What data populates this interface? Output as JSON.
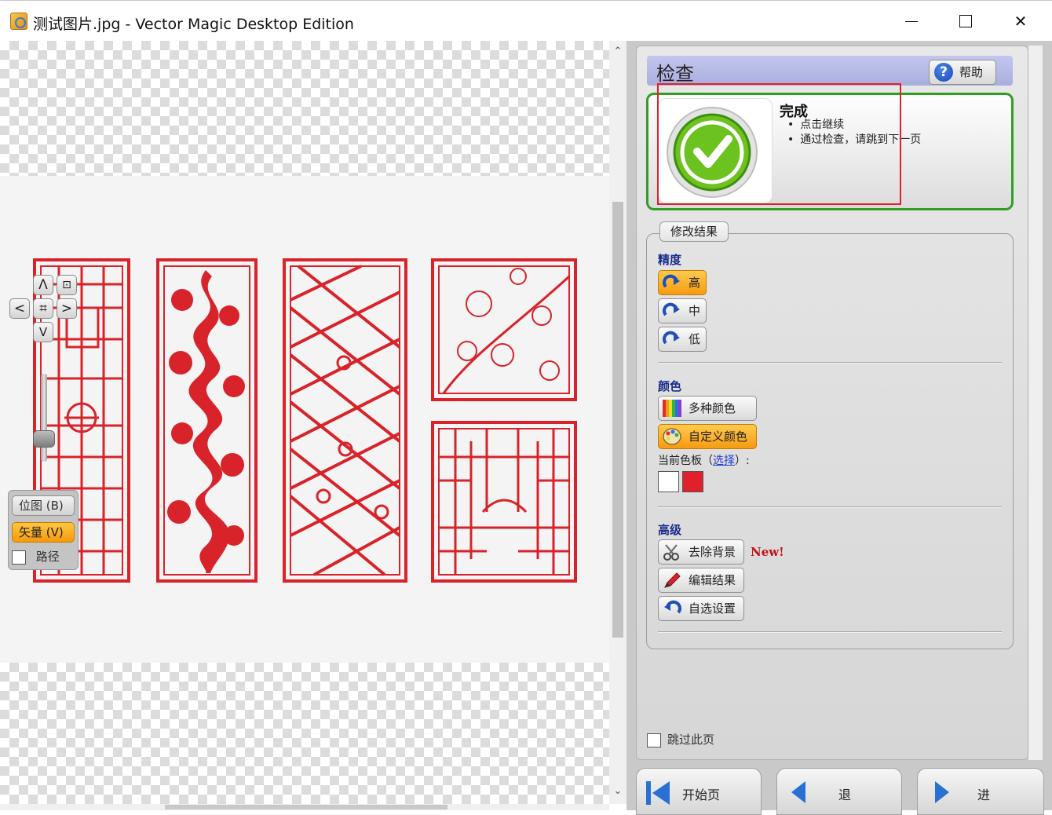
{
  "window": {
    "title": "测试图片.jpg - Vector Magic Desktop Edition",
    "controls": {
      "minimize": "",
      "maximize": "",
      "close": "✕"
    }
  },
  "canvas_nav": {
    "up": "Λ",
    "down": "V",
    "left": "<",
    "right": ">",
    "center": "⌗",
    "fit": "⊡"
  },
  "view_modes": {
    "bitmap": "位图  (B)",
    "vector": "矢量  (V)",
    "paths": "路径"
  },
  "panel": {
    "title": "检查",
    "help": "帮助",
    "status": {
      "title": "完成",
      "bullets": [
        "点击继续",
        "通过检查，请跳到下一页"
      ]
    },
    "group_label": "修改结果",
    "precision": {
      "label": "精度",
      "options": [
        "高",
        "中",
        "低"
      ],
      "selected": "高"
    },
    "color": {
      "label": "颜色",
      "options": [
        "多种颜色",
        "自定义颜色"
      ],
      "selected": "自定义颜色",
      "palette_label": "当前色板",
      "palette_link": "选择",
      "palette_prefix": "（",
      "palette_suffix": "）:",
      "swatches": [
        "#ffffff",
        "#e0202a"
      ]
    },
    "advanced": {
      "label": "高级",
      "remove_bg": "去除背景",
      "new_badge": "New!",
      "edit": "编辑结果",
      "settings": "自选设置"
    },
    "skip": "跳过此页"
  },
  "nav_buttons": {
    "start": "开始页",
    "back": "退",
    "next": "进"
  },
  "colors": {
    "accent_orange": "#f59b10",
    "status_green": "#2ea020",
    "design_red": "#d8232a",
    "header_blue": "#b0b4e4"
  }
}
